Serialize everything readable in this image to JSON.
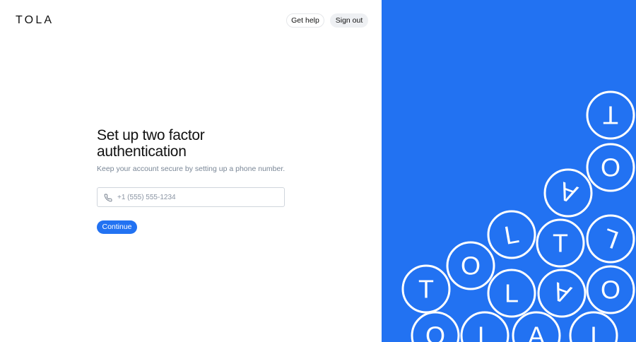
{
  "brand": {
    "logo": "TOLA"
  },
  "header": {
    "help_label": "Get help",
    "signout_label": "Sign out"
  },
  "main": {
    "title": "Set up two factor authentication",
    "subtitle": "Keep your account secure by setting up a phone number.",
    "phone_placeholder": "+1 (555) 555-1234",
    "continue_label": "Continue"
  },
  "decoration": {
    "background_color": "#2272f2",
    "accent_color": "#2272f2",
    "coins": [
      {
        "letter": "T",
        "rotation": 180
      },
      {
        "letter": "O",
        "rotation": 0
      },
      {
        "letter": "A",
        "rotation": 200
      },
      {
        "letter": "L",
        "rotation": -10
      },
      {
        "letter": "T",
        "rotation": 0
      },
      {
        "letter": "L",
        "rotation": 200
      },
      {
        "letter": "O",
        "rotation": 0
      },
      {
        "letter": "T",
        "rotation": 0
      },
      {
        "letter": "L",
        "rotation": 0
      },
      {
        "letter": "A",
        "rotation": 200
      },
      {
        "letter": "O",
        "rotation": 0
      },
      {
        "letter": "O",
        "rotation": 0
      },
      {
        "letter": "L",
        "rotation": 0
      },
      {
        "letter": "A",
        "rotation": 0
      },
      {
        "letter": "T",
        "rotation": 180
      }
    ]
  }
}
